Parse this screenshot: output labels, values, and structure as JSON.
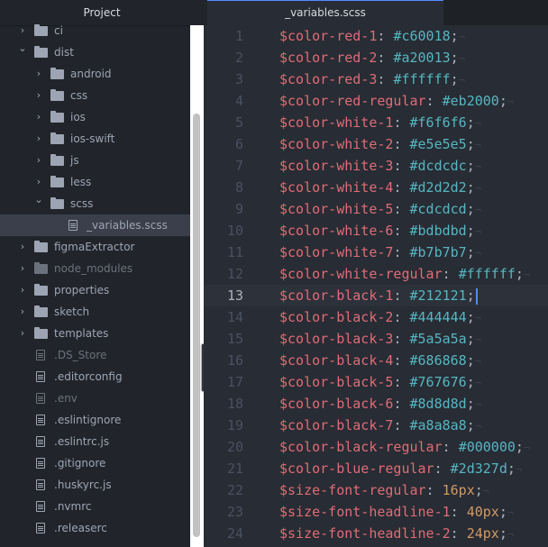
{
  "sidebar": {
    "title": "Project",
    "items": [
      {
        "type": "folder",
        "label": "ci",
        "depth": 0,
        "expanded": false,
        "dim": false
      },
      {
        "type": "folder",
        "label": "dist",
        "depth": 0,
        "expanded": true,
        "dim": false
      },
      {
        "type": "folder",
        "label": "android",
        "depth": 1,
        "expanded": false,
        "dim": false
      },
      {
        "type": "folder",
        "label": "css",
        "depth": 1,
        "expanded": false,
        "dim": false
      },
      {
        "type": "folder",
        "label": "ios",
        "depth": 1,
        "expanded": false,
        "dim": false
      },
      {
        "type": "folder",
        "label": "ios-swift",
        "depth": 1,
        "expanded": false,
        "dim": false
      },
      {
        "type": "folder",
        "label": "js",
        "depth": 1,
        "expanded": false,
        "dim": false
      },
      {
        "type": "folder",
        "label": "less",
        "depth": 1,
        "expanded": false,
        "dim": false
      },
      {
        "type": "folder",
        "label": "scss",
        "depth": 1,
        "expanded": true,
        "dim": false
      },
      {
        "type": "file",
        "label": "_variables.scss",
        "depth": 2,
        "selected": true,
        "dim": false
      },
      {
        "type": "folder",
        "label": "figmaExtractor",
        "depth": 0,
        "expanded": false,
        "dim": false
      },
      {
        "type": "folder",
        "label": "node_modules",
        "depth": 0,
        "expanded": false,
        "dim": true
      },
      {
        "type": "folder",
        "label": "properties",
        "depth": 0,
        "expanded": false,
        "dim": false
      },
      {
        "type": "folder",
        "label": "sketch",
        "depth": 0,
        "expanded": false,
        "dim": false
      },
      {
        "type": "folder",
        "label": "templates",
        "depth": 0,
        "expanded": false,
        "dim": false
      },
      {
        "type": "file",
        "label": ".DS_Store",
        "depth": 0,
        "dim": true
      },
      {
        "type": "file",
        "label": ".editorconfig",
        "depth": 0,
        "dim": false
      },
      {
        "type": "file",
        "label": ".env",
        "depth": 0,
        "dim": true
      },
      {
        "type": "file",
        "label": ".eslintignore",
        "depth": 0,
        "dim": false
      },
      {
        "type": "file",
        "label": ".eslintrc.js",
        "depth": 0,
        "dim": false
      },
      {
        "type": "file",
        "label": ".gitignore",
        "depth": 0,
        "dim": false
      },
      {
        "type": "file",
        "label": ".huskyrc.js",
        "depth": 0,
        "dim": false
      },
      {
        "type": "file",
        "label": ".nvmrc",
        "depth": 0,
        "dim": false
      },
      {
        "type": "file",
        "label": ".releaserc",
        "depth": 0,
        "dim": false
      }
    ],
    "collapse_glyph": "‹"
  },
  "tabs": {
    "active_label": "_variables.scss"
  },
  "editor": {
    "current_line": 13,
    "lines": [
      {
        "num": "1",
        "name": "$color-red-1",
        "value": "#c60018",
        "kind": "hex"
      },
      {
        "num": "2",
        "name": "$color-red-2",
        "value": "#a20013",
        "kind": "hex"
      },
      {
        "num": "3",
        "name": "$color-red-3",
        "value": "#ffffff",
        "kind": "hex"
      },
      {
        "num": "4",
        "name": "$color-red-regular",
        "value": "#eb2000",
        "kind": "hex"
      },
      {
        "num": "5",
        "name": "$color-white-1",
        "value": "#f6f6f6",
        "kind": "hex"
      },
      {
        "num": "6",
        "name": "$color-white-2",
        "value": "#e5e5e5",
        "kind": "hex"
      },
      {
        "num": "7",
        "name": "$color-white-3",
        "value": "#dcdcdc",
        "kind": "hex"
      },
      {
        "num": "8",
        "name": "$color-white-4",
        "value": "#d2d2d2",
        "kind": "hex"
      },
      {
        "num": "9",
        "name": "$color-white-5",
        "value": "#cdcdcd",
        "kind": "hex"
      },
      {
        "num": "10",
        "name": "$color-white-6",
        "value": "#bdbdbd",
        "kind": "hex"
      },
      {
        "num": "11",
        "name": "$color-white-7",
        "value": "#b7b7b7",
        "kind": "hex"
      },
      {
        "num": "12",
        "name": "$color-white-regular",
        "value": "#ffffff",
        "kind": "hex"
      },
      {
        "num": "13",
        "name": "$color-black-1",
        "value": "#212121",
        "kind": "hex"
      },
      {
        "num": "14",
        "name": "$color-black-2",
        "value": "#444444",
        "kind": "hex"
      },
      {
        "num": "15",
        "name": "$color-black-3",
        "value": "#5a5a5a",
        "kind": "hex"
      },
      {
        "num": "16",
        "name": "$color-black-4",
        "value": "#686868",
        "kind": "hex"
      },
      {
        "num": "17",
        "name": "$color-black-5",
        "value": "#767676",
        "kind": "hex"
      },
      {
        "num": "18",
        "name": "$color-black-6",
        "value": "#8d8d8d",
        "kind": "hex"
      },
      {
        "num": "19",
        "name": "$color-black-7",
        "value": "#a8a8a8",
        "kind": "hex"
      },
      {
        "num": "20",
        "name": "$color-black-regular",
        "value": "#000000",
        "kind": "hex"
      },
      {
        "num": "21",
        "name": "$color-blue-regular",
        "value": "#2d327d",
        "kind": "hex"
      },
      {
        "num": "22",
        "name": "$size-font-regular",
        "value": "16px",
        "kind": "num"
      },
      {
        "num": "23",
        "name": "$size-font-headline-1",
        "value": "40px",
        "kind": "num"
      },
      {
        "num": "24",
        "name": "$size-font-headline-2",
        "value": "24px",
        "kind": "num"
      }
    ]
  },
  "colors": {
    "variable": "#e06c75",
    "hex_value": "#56b6c2",
    "number_value": "#d19a66",
    "cursor": "#528bff"
  }
}
